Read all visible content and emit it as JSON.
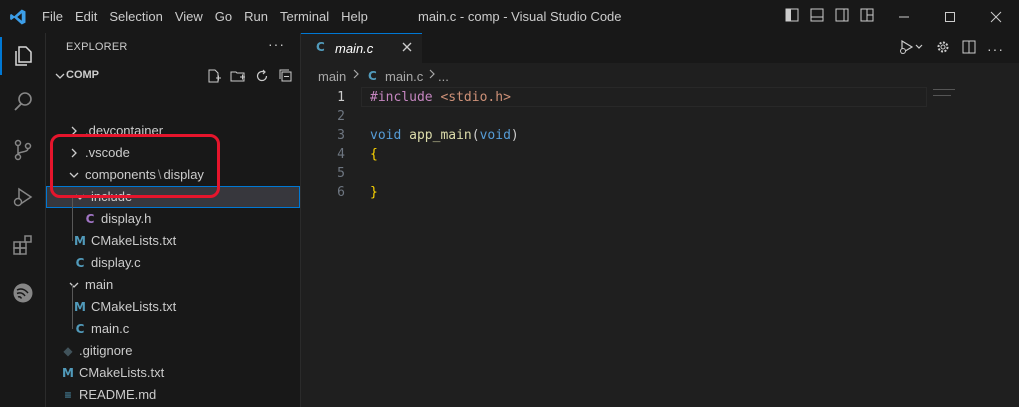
{
  "titlebar": {
    "menu": [
      "File",
      "Edit",
      "Selection",
      "View",
      "Go",
      "Run",
      "Terminal",
      "Help"
    ],
    "title": "main.c - comp - Visual Studio Code"
  },
  "activitybar": {
    "items": [
      "explorer-icon",
      "search-icon",
      "source-control-icon",
      "run-debug-icon",
      "extensions-icon",
      "esp-idf-icon"
    ]
  },
  "explorer": {
    "header": "EXPLORER",
    "more": "···",
    "folder": "COMP",
    "tree": [
      {
        "label": ".devcontainer",
        "kind": "folder-collapsed"
      },
      {
        "label": ".vscode",
        "kind": "folder-collapsed"
      },
      {
        "label": "components",
        "sep": "\\",
        "label2": "display",
        "kind": "folder-expanded"
      },
      {
        "label": "include",
        "kind": "folder-expanded",
        "selected": true
      },
      {
        "label": "display.h",
        "kind": "file",
        "icon": "C"
      },
      {
        "label": "CMakeLists.txt",
        "kind": "file",
        "icon": "M"
      },
      {
        "label": "display.c",
        "kind": "file",
        "icon": "C"
      },
      {
        "label": "main",
        "kind": "folder-expanded"
      },
      {
        "label": "CMakeLists.txt",
        "kind": "file",
        "icon": "M"
      },
      {
        "label": "main.c",
        "kind": "file",
        "icon": "C"
      },
      {
        "label": ".gitignore",
        "kind": "file",
        "icon": "◆"
      },
      {
        "label": "CMakeLists.txt",
        "kind": "file",
        "icon": "M"
      },
      {
        "label": "README.md",
        "kind": "file",
        "icon": "≡"
      }
    ]
  },
  "editor": {
    "tab": {
      "label": "main.c",
      "icon": "C"
    },
    "breadcrumb": [
      "main",
      "main.c",
      "..."
    ],
    "lines": [
      {
        "n": "1",
        "parts": [
          {
            "c": "tk-pp",
            "t": "#include "
          },
          {
            "c": "tk-inc",
            "t": "<stdio.h>"
          }
        ]
      },
      {
        "n": "2",
        "parts": []
      },
      {
        "n": "3",
        "parts": [
          {
            "c": "tk-kw",
            "t": "void "
          },
          {
            "c": "tk-fn",
            "t": "app_main"
          },
          {
            "c": "tk-txt",
            "t": "("
          },
          {
            "c": "tk-kw",
            "t": "void"
          },
          {
            "c": "tk-txt",
            "t": ")"
          }
        ]
      },
      {
        "n": "4",
        "parts": [
          {
            "c": "tk-br",
            "t": "{"
          }
        ]
      },
      {
        "n": "5",
        "parts": []
      },
      {
        "n": "6",
        "parts": [
          {
            "c": "tk-br",
            "t": "}"
          }
        ]
      }
    ]
  },
  "colors": {
    "accent": "#0078d4",
    "highlight": "#e5152c"
  }
}
